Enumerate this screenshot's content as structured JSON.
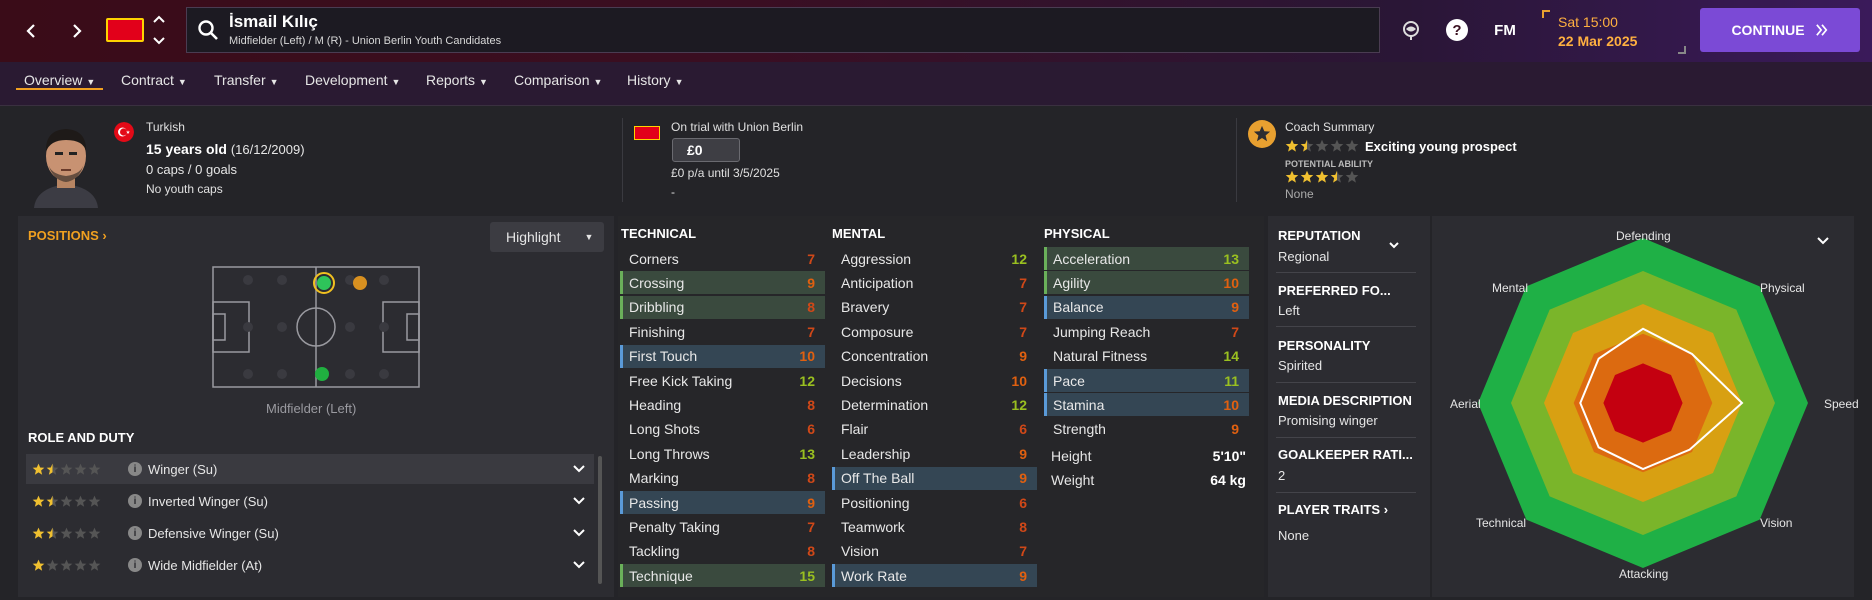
{
  "header": {
    "player_name": "İsmail Kılıç",
    "player_subtitle": "Midfielder (Left) / M (R) - Union Berlin Youth Candidates",
    "fm_logo": "FM",
    "day_time": "Sat 15:00",
    "date": "22 Mar 2025",
    "continue_label": "CONTINUE"
  },
  "tabs": [
    {
      "label": "Overview"
    },
    {
      "label": "Contract"
    },
    {
      "label": "Transfer"
    },
    {
      "label": "Development"
    },
    {
      "label": "Reports"
    },
    {
      "label": "Comparison"
    },
    {
      "label": "History"
    }
  ],
  "bio": {
    "nationality": "Turkish",
    "age": "15 years old",
    "dob": "(16/12/2009)",
    "caps": "0 caps / 0 goals",
    "youth_caps": "No youth caps"
  },
  "contract": {
    "status": "On trial with Union Berlin",
    "fee": "£0",
    "wage": "£0 p/a until 3/5/2025",
    "extra": "-"
  },
  "coach": {
    "title": "Coach Summary",
    "verdict": "Exciting young prospect",
    "potential_label": "POTENTIAL ABILITY",
    "potential_value": "None",
    "current_stars": 1.5,
    "potential_stars": 3.5
  },
  "positions": {
    "header": "POSITIONS",
    "highlight_label": "Highlight",
    "position_label": "Midfielder (Left)"
  },
  "role_duty": {
    "header": "ROLE AND DUTY",
    "rows": [
      {
        "label": "Winger (Su)",
        "stars": 1.5,
        "selected": true
      },
      {
        "label": "Inverted Winger (Su)",
        "stars": 1.5,
        "selected": false
      },
      {
        "label": "Defensive Winger (Su)",
        "stars": 1.5,
        "selected": false
      },
      {
        "label": "Wide Midfielder (At)",
        "stars": 1,
        "selected": false
      }
    ]
  },
  "attributes": {
    "technical_header": "TECHNICAL",
    "mental_header": "MENTAL",
    "physical_header": "PHYSICAL",
    "technical": [
      {
        "name": "Corners",
        "value": "7",
        "hl": ""
      },
      {
        "name": "Crossing",
        "value": "9",
        "hl": "green"
      },
      {
        "name": "Dribbling",
        "value": "8",
        "hl": "green"
      },
      {
        "name": "Finishing",
        "value": "7",
        "hl": ""
      },
      {
        "name": "First Touch",
        "value": "10",
        "hl": "blue"
      },
      {
        "name": "Free Kick Taking",
        "value": "12",
        "hl": ""
      },
      {
        "name": "Heading",
        "value": "8",
        "hl": ""
      },
      {
        "name": "Long Shots",
        "value": "6",
        "hl": ""
      },
      {
        "name": "Long Throws",
        "value": "13",
        "hl": ""
      },
      {
        "name": "Marking",
        "value": "8",
        "hl": ""
      },
      {
        "name": "Passing",
        "value": "9",
        "hl": "blue"
      },
      {
        "name": "Penalty Taking",
        "value": "7",
        "hl": ""
      },
      {
        "name": "Tackling",
        "value": "8",
        "hl": ""
      },
      {
        "name": "Technique",
        "value": "15",
        "hl": "green"
      }
    ],
    "mental": [
      {
        "name": "Aggression",
        "value": "12",
        "hl": ""
      },
      {
        "name": "Anticipation",
        "value": "7",
        "hl": ""
      },
      {
        "name": "Bravery",
        "value": "7",
        "hl": ""
      },
      {
        "name": "Composure",
        "value": "7",
        "hl": ""
      },
      {
        "name": "Concentration",
        "value": "9",
        "hl": ""
      },
      {
        "name": "Decisions",
        "value": "10",
        "hl": ""
      },
      {
        "name": "Determination",
        "value": "12",
        "hl": ""
      },
      {
        "name": "Flair",
        "value": "6",
        "hl": ""
      },
      {
        "name": "Leadership",
        "value": "9",
        "hl": ""
      },
      {
        "name": "Off The Ball",
        "value": "9",
        "hl": "blue"
      },
      {
        "name": "Positioning",
        "value": "6",
        "hl": ""
      },
      {
        "name": "Teamwork",
        "value": "8",
        "hl": ""
      },
      {
        "name": "Vision",
        "value": "7",
        "hl": ""
      },
      {
        "name": "Work Rate",
        "value": "9",
        "hl": "blue"
      }
    ],
    "physical": [
      {
        "name": "Acceleration",
        "value": "13",
        "hl": "green"
      },
      {
        "name": "Agility",
        "value": "10",
        "hl": "green"
      },
      {
        "name": "Balance",
        "value": "9",
        "hl": "blue"
      },
      {
        "name": "Jumping Reach",
        "value": "7",
        "hl": ""
      },
      {
        "name": "Natural Fitness",
        "value": "14",
        "hl": ""
      },
      {
        "name": "Pace",
        "value": "11",
        "hl": "blue"
      },
      {
        "name": "Stamina",
        "value": "10",
        "hl": "blue"
      },
      {
        "name": "Strength",
        "value": "9",
        "hl": ""
      }
    ],
    "height_label": "Height",
    "height": "5'10\"",
    "weight_label": "Weight",
    "weight": "64 kg"
  },
  "profile": {
    "reputation_label": "REPUTATION",
    "reputation": "Regional",
    "foot_label": "PREFERRED FO...",
    "foot": "Left",
    "personality_label": "PERSONALITY",
    "personality": "Spirited",
    "media_label": "MEDIA DESCRIPTION",
    "media": "Promising winger",
    "gk_label": "GOALKEEPER RATI...",
    "gk": "2",
    "traits_label": "PLAYER TRAITS",
    "traits": "None"
  },
  "radar": {
    "labels": [
      "Defending",
      "Physical",
      "Speed",
      "Vision",
      "Attacking",
      "Technical",
      "Aerial",
      "Mental"
    ],
    "values": [
      0.45,
      0.42,
      0.6,
      0.4,
      0.4,
      0.38,
      0.38,
      0.38
    ]
  },
  "colors": {
    "accent": "#f0a020",
    "continue": "#7b4ad6",
    "green_value": "#9ac020",
    "orange_value": "#e06010",
    "low_value": "#d04818"
  }
}
